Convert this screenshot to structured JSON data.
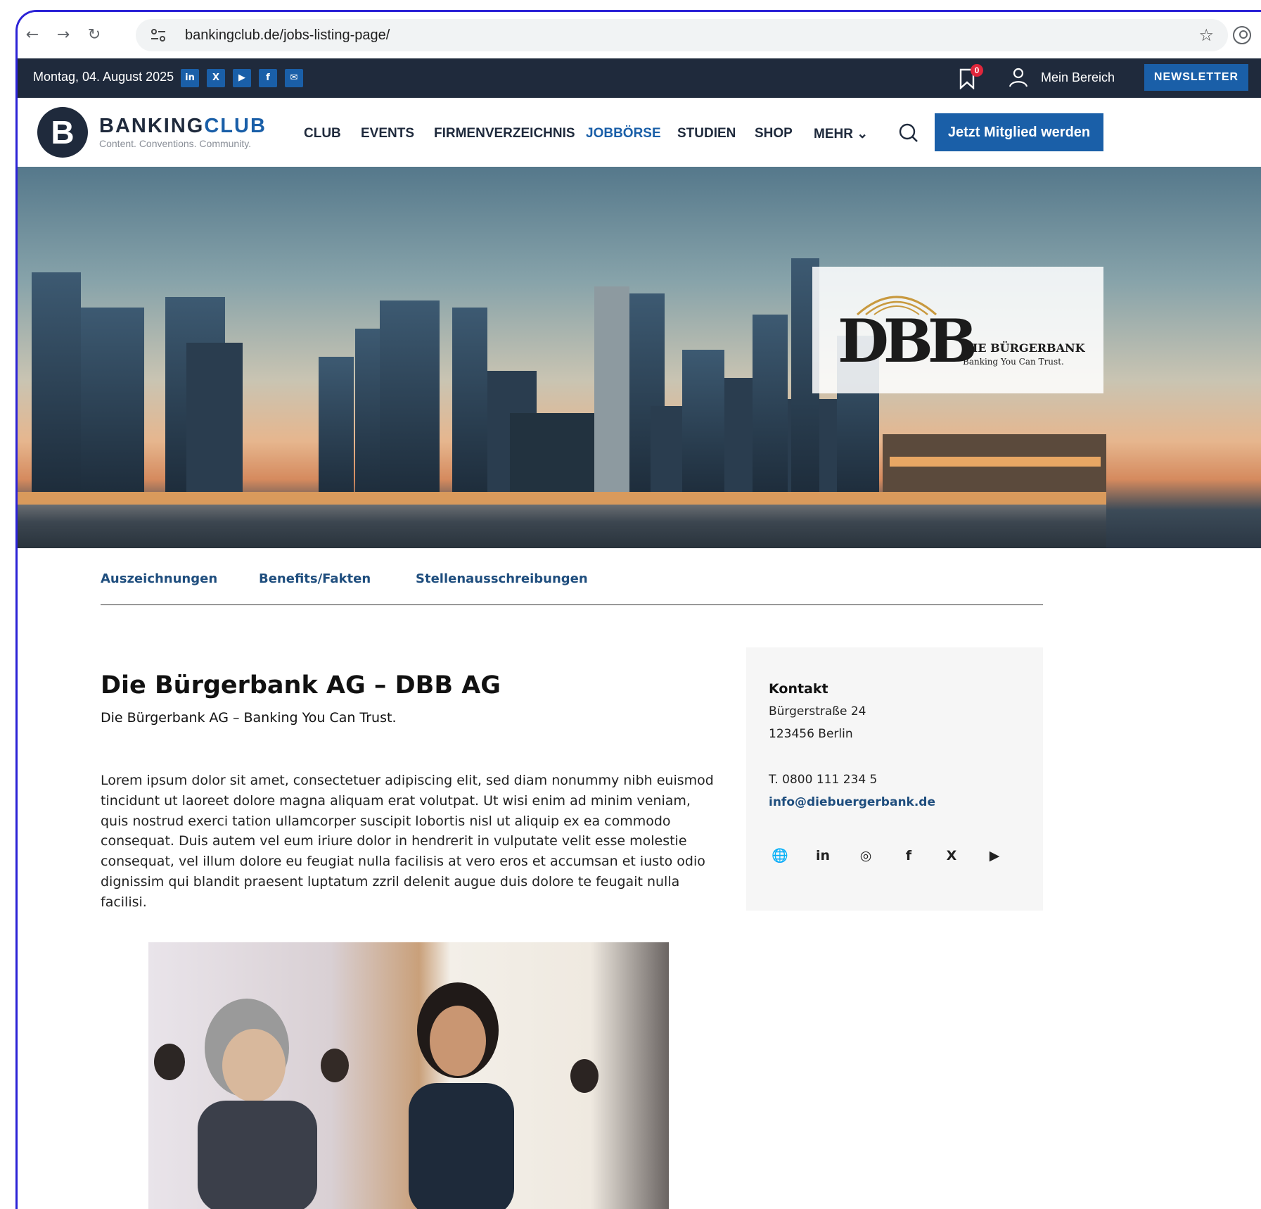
{
  "browser": {
    "url": "bankingclub.de/jobs-listing-page/",
    "icons": [
      "back-icon",
      "forward-icon",
      "reload-icon",
      "site-settings-icon",
      "star-icon",
      "profile-icon"
    ]
  },
  "topbar": {
    "date": "Montag, 04. August 2025",
    "social": [
      "in",
      "X",
      "▶",
      "f",
      "✉"
    ],
    "bookmark_count": "0",
    "mein_bereich": "Mein Bereich",
    "newsletter": "NEWSLETTER"
  },
  "header": {
    "logo_letter": "B",
    "logo_word_1": "BANKING",
    "logo_word_2": "CLUB",
    "logo_tagline": "Content. Conventions. Community.",
    "menu": [
      "CLUB",
      "EVENTS",
      "FIRMENVERZEICHNIS",
      "JOBBÖRSE",
      "STUDIEN",
      "SHOP",
      "MEHR ⌄"
    ],
    "active_menu": "JOBBÖRSE",
    "cta": "Jetzt Mitglied werden"
  },
  "hero": {
    "logo_mark": "DBB",
    "logo_name": "DIE BÜRGERBANK",
    "logo_tagline": "Banking You Can Trust."
  },
  "tabs": [
    "Auszeichnungen",
    "Benefits/Fakten",
    "Stellenausschreibungen"
  ],
  "content": {
    "title": "Die Bürgerbank AG – DBB AG",
    "subtitle": "Die Bürgerbank AG – Banking You Can Trust.",
    "body": "Lorem ipsum dolor sit amet, consectetuer adipiscing elit, sed diam nonummy nibh euis­mod tincidunt ut laoreet dolore magna aliquam erat volutpat. Ut wisi enim ad minim veniam, quis nostrud exerci tation ullamcorper suscipit lobortis nisl ut aliquip ex ea com­modo consequat. Duis autem vel eum iriure dolor in hendrerit in vulputate velit esse mo­lestie consequat, vel illum dolore eu feugiat nulla facilisis at vero eros et accumsan et iusto odio dignissim qui blandit praesent luptatum zzril delenit augue duis dolore te feu­gait nulla facilisi."
  },
  "contact": {
    "title": "Kontakt",
    "street": "Bürgerstraße 24",
    "city": "123456 Berlin",
    "phone": "T. 0800 111 234 5",
    "email": "info@diebuergerbank.de",
    "social": [
      "🌐",
      "in",
      "◎",
      "f",
      "X",
      "▶"
    ]
  },
  "colors": {
    "brand_dark": "#1f2a3c",
    "brand_blue": "#1a5fa8",
    "link_blue": "#1f4e7e",
    "badge_red": "#e0263b"
  }
}
